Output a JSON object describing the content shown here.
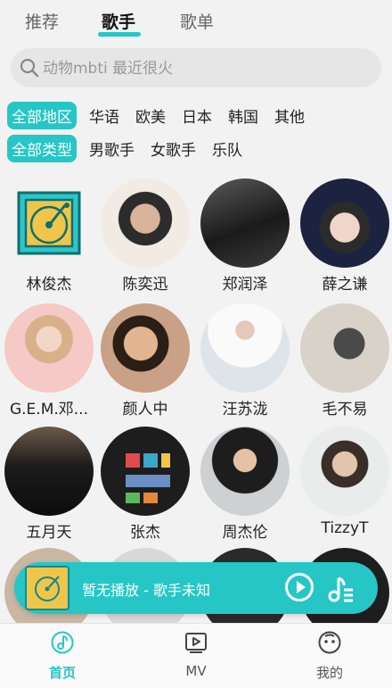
{
  "top_tabs": [
    "推荐",
    "歌手",
    "歌单"
  ],
  "search": {
    "placeholder": "动物mbti 最近很火"
  },
  "filters": {
    "region": [
      "全部地区",
      "华语",
      "欧美",
      "日本",
      "韩国",
      "其他"
    ],
    "type": [
      "全部类型",
      "男歌手",
      "女歌手",
      "乐队"
    ]
  },
  "artists": [
    {
      "name": "林俊杰"
    },
    {
      "name": "陈奕迅"
    },
    {
      "name": "郑润泽"
    },
    {
      "name": "薛之谦"
    },
    {
      "name": "G.E.M.邓..."
    },
    {
      "name": "颜人中"
    },
    {
      "name": "汪苏泷"
    },
    {
      "name": "毛不易"
    },
    {
      "name": "五月天"
    },
    {
      "name": "张杰"
    },
    {
      "name": "周杰伦"
    },
    {
      "name": "TizzyT"
    }
  ],
  "player": {
    "title": "暂无播放 - 歌手未知"
  },
  "bottom_nav": [
    "首页",
    "MV",
    "我的"
  ],
  "colors": {
    "accent": "#26c6c6",
    "background": "#f2f2f2"
  }
}
